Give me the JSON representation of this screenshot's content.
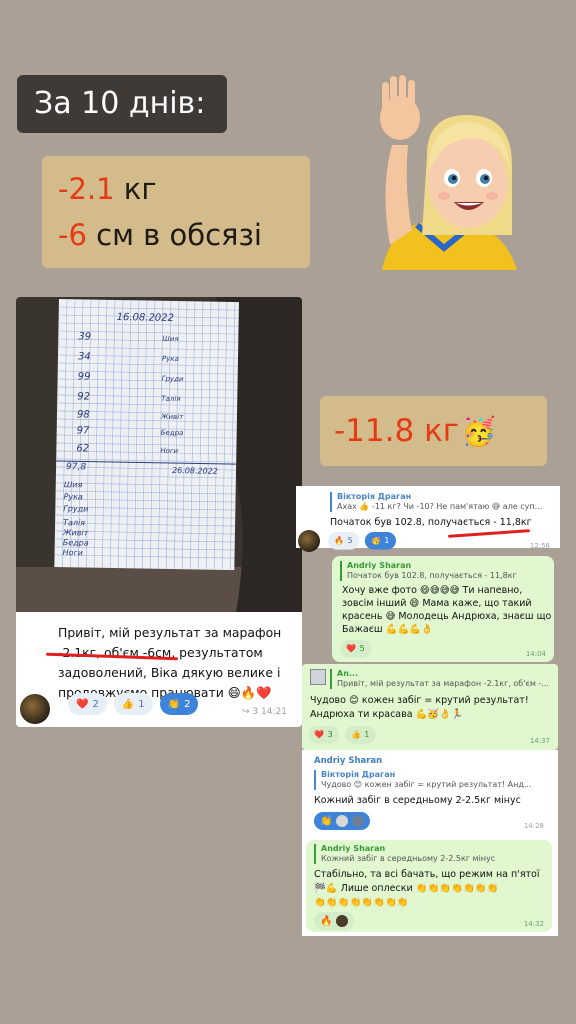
{
  "story": {
    "title": "За 10 днів:",
    "stat1_num": "-2.1",
    "stat1_unit": " кг",
    "stat2_num": "-6",
    "stat2_unit": " см в обсязі",
    "total_loss": "-11.8 кг",
    "total_loss_emoji": "🥳"
  },
  "notebook": {
    "date_top": "16.08.2022",
    "date_bottom": "26.08.2022",
    "rows_top": [
      "39",
      "34",
      "99",
      "92",
      "98",
      "97",
      "62"
    ],
    "labels": [
      "Шия",
      "Рука",
      "Груди",
      "Талія",
      "Живіт",
      "Бедра",
      "Ноги"
    ],
    "total": "97,8"
  },
  "left_message": {
    "text_line1": "Привіт, мій результат за марафон",
    "text_line2": "-2.1кг, об'єм -6см, результатом",
    "text_line3": "задоволений, Віка дякую велике і",
    "text_line4": "продовжуємо працювати 😄🔥❤️",
    "reactions": [
      {
        "emoji": "❤️",
        "count": "2"
      },
      {
        "emoji": "👍",
        "count": "1"
      },
      {
        "emoji": "👏",
        "count": "2"
      }
    ],
    "views": "3",
    "time": "14:21"
  },
  "chat_a": {
    "reply_name": "Вікторія Драган",
    "reply_text": "Ахах 👍 -11 кг? Чи -10? Не пам'ятаю 😅 але суп...",
    "text": "Початок був 102.8, получається - 11,8кг",
    "reactions": [
      {
        "emoji": "🔥",
        "count": "5"
      },
      {
        "emoji": "🥳",
        "count": "1"
      }
    ],
    "time": "12:58"
  },
  "chat_b": {
    "reply_name": "Andriy Sharan",
    "reply_text": "Початок був 102.8, получається - 11,8кг",
    "text_line1": "Хочу вже фото 😄😅😅😅 Ти напевно,",
    "text_line2": "зовсім інший 😄 Мама каже, що такий",
    "text_line3": "красень 😅 Молодець Андрюха, знаєш що",
    "text_line4": "Бажаєш 💪💪💪👌",
    "reactions": [
      {
        "emoji": "❤️",
        "count": "5"
      }
    ],
    "time": "14:04"
  },
  "chat_c": {
    "reply_name": "An...",
    "reply_text": "Привіт, мій результат за марафон -2.1кг, об'єм -...",
    "text_line1": "Чудово 😊 кожен забіг = крутий результат!",
    "text_line2": "Андрюха ти красава 💪🥳👌🏃",
    "reactions": [
      {
        "emoji": "❤️",
        "count": "3"
      },
      {
        "emoji": "👍",
        "count": "1"
      }
    ],
    "time": "14:37"
  },
  "chat_d": {
    "sender": "Andriy Sharan",
    "reply_name": "Вікторія Драган",
    "reply_text": "Чудово 😊 кожен забіг = крутий результат! Анд...",
    "text": "Кожний забіг в середньому 2-2.5кг мінус",
    "time": "14:28"
  },
  "chat_e": {
    "reply_name": "Andriy Sharan",
    "reply_text": "Кожний забіг в середньому 2-2.5кг мінус",
    "text_line1": "Стабільно, та всі бачать, що режим на п'ятої",
    "text_line2": "🏁💪 Лише оплески 👏👏👏👏👏👏👏",
    "text_line3": "👏👏👏👏👏👏👏👏",
    "time": "14:32"
  },
  "colors": {
    "background": "#aba095",
    "card_tan": "#d3bb8c",
    "title_dark": "#3f3a36",
    "accent_red": "#e53a12",
    "bubble_green": "#e0f7cf"
  }
}
